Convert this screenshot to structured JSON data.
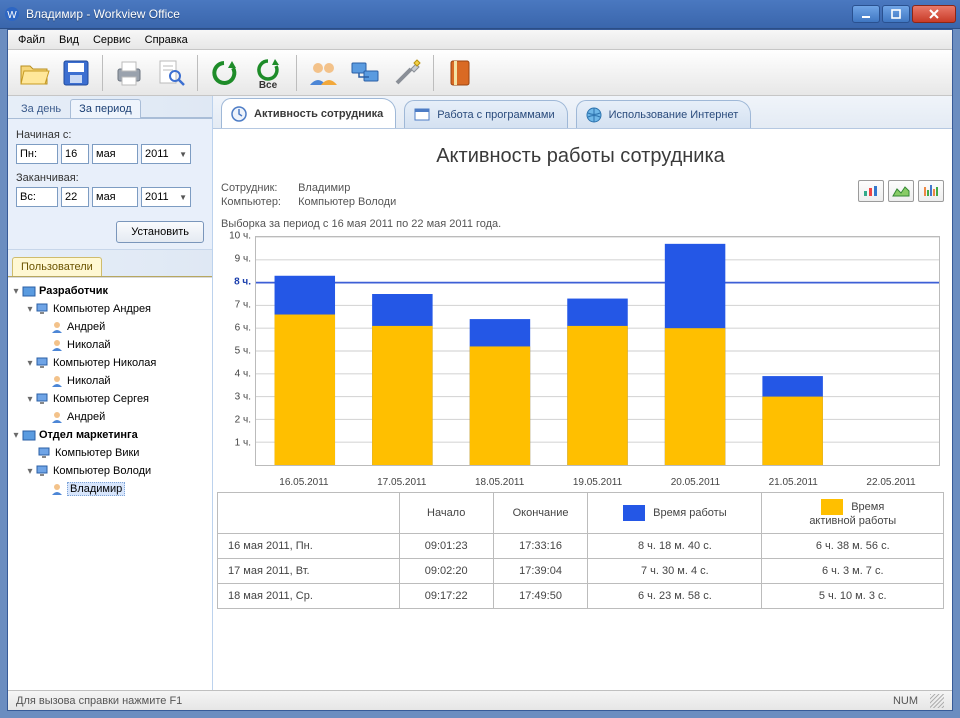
{
  "window": {
    "title": "Владимир - Workview Office"
  },
  "menu": {
    "file": "Файл",
    "view": "Вид",
    "service": "Сервис",
    "help": "Справка"
  },
  "toolbar": {
    "open": "open",
    "save": "save",
    "print": "print",
    "find": "find",
    "refresh": "refresh",
    "refresh_all_label": "Все",
    "users": "users",
    "computers": "computers",
    "settings": "settings",
    "book": "book"
  },
  "range_tabs": {
    "day": "За день",
    "period": "За период",
    "active": "period"
  },
  "date": {
    "from_label": "Начиная с:",
    "from_dow": "Пн:",
    "from_day": "16",
    "from_month": "мая",
    "from_year": "2011",
    "to_label": "Заканчивая:",
    "to_dow": "Вс:",
    "to_day": "22",
    "to_month": "мая",
    "to_year": "2011",
    "apply": "Установить"
  },
  "users_tab": "Пользователи",
  "tree": {
    "n0": "Разработчик",
    "n1": "Компьютер Андрея",
    "n1a": "Андрей",
    "n1b": "Николай",
    "n2": "Компьютер Николая",
    "n2a": "Николай",
    "n3": "Компьютер Сергея",
    "n3a": "Андрей",
    "m0": "Отдел маркетинга",
    "m1": "Компьютер Вики",
    "m2": "Компьютер Володи",
    "m2a": "Владимир"
  },
  "bigtabs": {
    "activity": "Активность сотрудника",
    "programs": "Работа с программами",
    "internet": "Использование Интернет"
  },
  "report": {
    "title": "Активность работы сотрудника",
    "employee_k": "Сотрудник:",
    "employee_v": "Владимир",
    "computer_k": "Компьютер:",
    "computer_v": "Компьютер Володи",
    "selection": "Выборка за период с 16 мая 2011 по 22 мая 2011 года."
  },
  "table": {
    "h1": "Начало",
    "h2": "Окончание",
    "h3": "Время работы",
    "h4": "Время\nактивной работы",
    "r1d": "16 мая 2011, Пн.",
    "r1a": "09:01:23",
    "r1b": "17:33:16",
    "r1c": "8 ч. 18 м. 40 с.",
    "r1e": "6 ч. 38 м. 56 с.",
    "r2d": "17 мая 2011, Вт.",
    "r2a": "09:02:20",
    "r2b": "17:39:04",
    "r2c": "7 ч. 30 м. 4 с.",
    "r2e": "6 ч. 3 м. 7 с.",
    "r3d": "18 мая 2011, Ср.",
    "r3a": "09:17:22",
    "r3b": "17:49:50",
    "r3c": "6 ч. 23 м. 58 с.",
    "r3e": "5 ч. 10 м. 3 с."
  },
  "statusbar": {
    "hint": "Для вызова справки нажмите F1",
    "num": "NUM"
  },
  "chart_data": {
    "type": "bar",
    "title": "Активность работы сотрудника",
    "ylabel": "часы",
    "ylim": [
      0,
      10
    ],
    "yticks": [
      1,
      2,
      3,
      4,
      5,
      6,
      7,
      8,
      9,
      10
    ],
    "ytick_labels": [
      "1 ч.",
      "2 ч.",
      "3 ч.",
      "4 ч.",
      "5 ч.",
      "6 ч.",
      "7 ч.",
      "8 ч.",
      "9 ч.",
      "10 ч."
    ],
    "reference_line": 8,
    "categories": [
      "16.05.2011",
      "17.05.2011",
      "18.05.2011",
      "19.05.2011",
      "20.05.2011",
      "21.05.2011",
      "22.05.2011"
    ],
    "series": [
      {
        "name": "Время работы",
        "color": "#2457e6",
        "values": [
          8.3,
          7.5,
          6.4,
          7.3,
          9.7,
          3.9,
          0
        ]
      },
      {
        "name": "Время активной работы",
        "color": "#ffbf00",
        "values": [
          6.6,
          6.1,
          5.2,
          6.1,
          6.0,
          3.0,
          0
        ]
      }
    ]
  }
}
